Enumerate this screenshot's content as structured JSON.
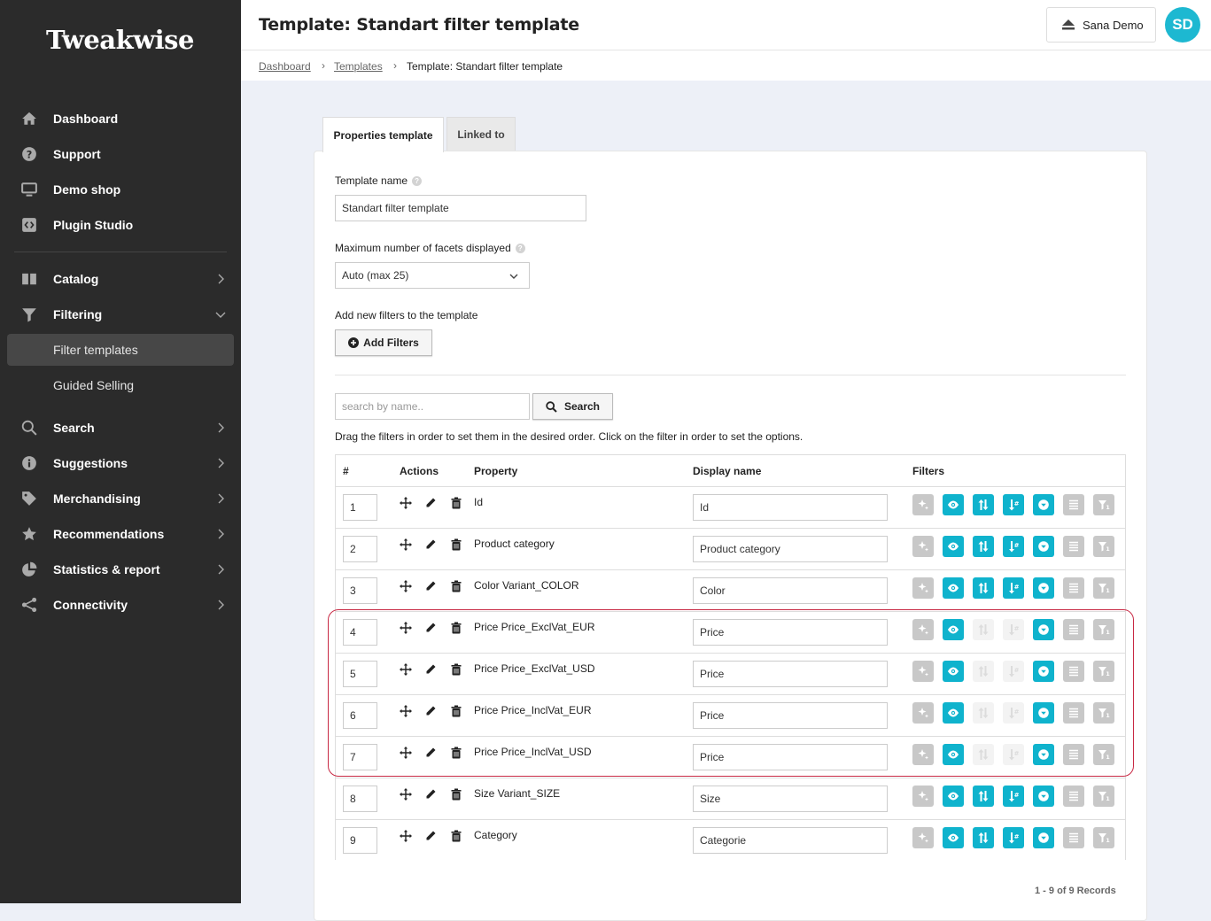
{
  "app": {
    "logo_text": "Tweakwise"
  },
  "sidebar": {
    "items": [
      {
        "label": "Dashboard",
        "icon": "home-icon"
      },
      {
        "label": "Support",
        "icon": "question-circle-icon"
      },
      {
        "label": "Demo shop",
        "icon": "monitor-icon"
      },
      {
        "label": "Plugin Studio",
        "icon": "code-icon"
      },
      {
        "label": "Catalog",
        "icon": "book-icon"
      },
      {
        "label": "Filtering",
        "icon": "funnel-icon"
      },
      {
        "label": "Filter templates"
      },
      {
        "label": "Guided Selling"
      },
      {
        "label": "Search",
        "icon": "search-icon"
      },
      {
        "label": "Suggestions",
        "icon": "info-icon"
      },
      {
        "label": "Merchandising",
        "icon": "tag-icon"
      },
      {
        "label": "Recommendations",
        "icon": "star-icon"
      },
      {
        "label": "Statistics & report",
        "icon": "pie-chart-icon"
      },
      {
        "label": "Connectivity",
        "icon": "share-icon"
      }
    ]
  },
  "header": {
    "title": "Template: Standart filter template",
    "account_label": "Sana Demo",
    "avatar_initials": "SD"
  },
  "breadcrumb": {
    "items": [
      "Dashboard",
      "Templates",
      "Template: Standart filter template"
    ]
  },
  "tabs": [
    {
      "label": "Properties template"
    },
    {
      "label": "Linked to"
    }
  ],
  "form": {
    "template_name_label": "Template name",
    "template_name_value": "Standart filter template",
    "max_facets_label": "Maximum number of facets displayed",
    "max_facets_value": "Auto (max 25)",
    "add_filters_label": "Add new filters to the template",
    "add_filters_button": "Add Filters",
    "search_placeholder": "search by name..",
    "search_button": "Search",
    "drag_hint": "Drag the filters in order to set them in the desired order. Click on the filter in order to set the options."
  },
  "table": {
    "headers": [
      "#",
      "Actions",
      "Property",
      "Display name",
      "Filters"
    ],
    "rows": [
      {
        "num": "1",
        "property": "Id",
        "display": "Id",
        "sort_enabled": true
      },
      {
        "num": "2",
        "property": "Product category",
        "display": "Product category",
        "sort_enabled": true
      },
      {
        "num": "3",
        "property": "Color Variant_COLOR",
        "display": "Color",
        "sort_enabled": true
      },
      {
        "num": "4",
        "property": "Price Price_ExclVat_EUR",
        "display": "Price",
        "sort_enabled": false
      },
      {
        "num": "5",
        "property": "Price Price_ExclVat_USD",
        "display": "Price",
        "sort_enabled": false
      },
      {
        "num": "6",
        "property": "Price Price_InclVat_EUR",
        "display": "Price",
        "sort_enabled": false
      },
      {
        "num": "7",
        "property": "Price Price_InclVat_USD",
        "display": "Price",
        "sort_enabled": false
      },
      {
        "num": "8",
        "property": "Size Variant_SIZE",
        "display": "Size",
        "sort_enabled": true
      },
      {
        "num": "9",
        "property": "Category",
        "display": "Categorie",
        "sort_enabled": true
      }
    ],
    "records_text": "1 - 9 of 9 Records"
  },
  "colors": {
    "accent": "#0fb3cd",
    "highlight": "#c82944",
    "sidebar_bg": "#2b2b2b"
  }
}
